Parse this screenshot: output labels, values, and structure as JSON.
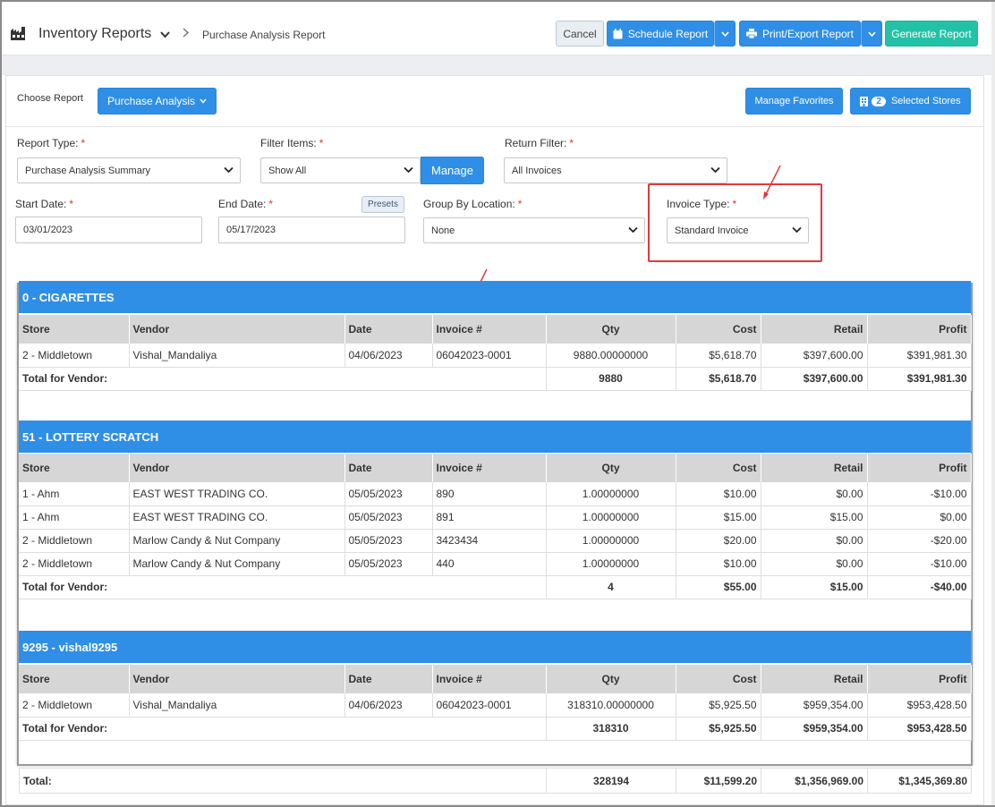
{
  "header": {
    "app_title": "Inventory Reports",
    "breadcrumb": "Purchase Analysis Report",
    "cancel_label": "Cancel",
    "schedule_label": "Schedule Report",
    "print_label": "Print/Export Report",
    "generate_label": "Generate Report"
  },
  "toolbar": {
    "choose_report_label": "Choose Report",
    "choose_report_value": "Purchase Analysis",
    "manage_favorites_label": "Manage Favorites",
    "selected_stores_count": "2",
    "selected_stores_label": "Selected Stores"
  },
  "filters": {
    "report_type_label": "Report Type:",
    "report_type_value": "Purchase Analysis Summary",
    "filter_items_label": "Filter Items:",
    "filter_items_value": "Show All",
    "manage_label": "Manage",
    "return_filter_label": "Return Filter:",
    "return_filter_value": "All Invoices",
    "start_date_label": "Start Date:",
    "start_date_value": "03/01/2023",
    "end_date_label": "End Date:",
    "end_date_value": "05/17/2023",
    "presets_label": "Presets",
    "group_by_label": "Group By Location:",
    "group_by_value": "None",
    "invoice_type_label": "Invoice Type:",
    "invoice_type_value": "Standard Invoice",
    "required_mark": "*"
  },
  "columns": [
    "Store",
    "Vendor",
    "Date",
    "Invoice #",
    "Qty",
    "Cost",
    "Retail",
    "Profit"
  ],
  "total_for_vendor_label": "Total for Vendor:",
  "sections": [
    {
      "title": "0 - CIGARETTES",
      "rows": [
        [
          "2 - Middletown",
          "Vishal_Mandaliya",
          "04/06/2023",
          "06042023-0001",
          "9880.00000000",
          "$5,618.70",
          "$397,600.00",
          "$391,981.30"
        ]
      ],
      "total": [
        "9880",
        "$5,618.70",
        "$397,600.00",
        "$391,981.30"
      ]
    },
    {
      "title": "51 - LOTTERY SCRATCH",
      "rows": [
        [
          "1 - Ahm",
          "EAST WEST TRADING CO.",
          "05/05/2023",
          "890",
          "1.00000000",
          "$10.00",
          "$0.00",
          "-$10.00"
        ],
        [
          "1 - Ahm",
          "EAST WEST TRADING CO.",
          "05/05/2023",
          "891",
          "1.00000000",
          "$15.00",
          "$15.00",
          "$0.00"
        ],
        [
          "2 - Middletown",
          "Marlow Candy & Nut Company",
          "05/05/2023",
          "3423434",
          "1.00000000",
          "$20.00",
          "$0.00",
          "-$20.00"
        ],
        [
          "2 - Middletown",
          "Marlow Candy & Nut Company",
          "05/05/2023",
          "440",
          "1.00000000",
          "$10.00",
          "$0.00",
          "-$10.00"
        ]
      ],
      "total": [
        "4",
        "$55.00",
        "$15.00",
        "-$40.00"
      ]
    },
    {
      "title": "9295 - vishal9295",
      "rows": [
        [
          "2 - Middletown",
          "Vishal_Mandaliya",
          "04/06/2023",
          "06042023-0001",
          "318310.00000000",
          "$5,925.50",
          "$959,354.00",
          "$953,428.50"
        ]
      ],
      "total": [
        "318310",
        "$5,925.50",
        "$959,354.00",
        "$953,428.50"
      ]
    }
  ],
  "grand_total": {
    "label": "Total:",
    "values": [
      "328194",
      "$11,599.20",
      "$1,356,969.00",
      "$1,345,369.80"
    ]
  },
  "colors": {
    "primary": "#2f8fe6",
    "teal": "#23c2a7",
    "annotation_red": "#e0393e"
  }
}
